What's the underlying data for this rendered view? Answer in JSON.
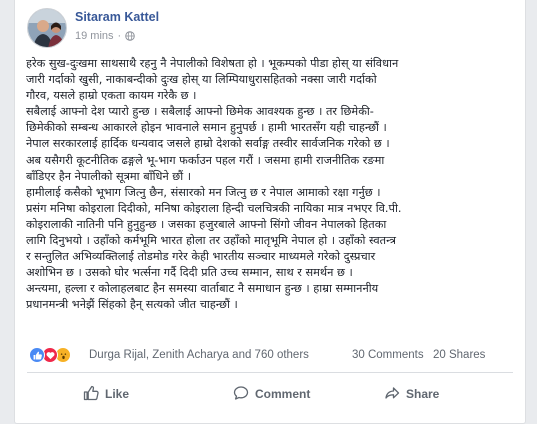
{
  "post": {
    "author": "Sitaram Kattel",
    "time": "19 mins",
    "separator": "·",
    "lines": [
      "हरेक सुख-दुःखमा साथसाथै रहनु नै नेपालीको विशेषता हो । भूकम्पको पीडा होस् या संविधान",
      "जारी गर्दाको खुसी, नाकाबन्दीको दुःख होस् या लिम्पियाधुरासहितको नक्सा जारी गर्दाको",
      "गौरव, यसले हाम्रो एकता कायम गरेकै छ ।",
      "सबैलाई आफ्नो देश प्यारो हुन्छ । सबैलाई आफ्नो छिमेक आवश्यक हुन्छ । तर छिमेकी-",
      "छिमेकीको सम्बन्ध आकारले होइन भावनाले समान हुनुपर्छ । हामी भारतसँग यही चाहन्छौं ।",
      "नेपाल सरकारलाई हार्दिक धन्यवाद जसले हाम्रो देशको सर्वाङ्ग तस्वीर सार्वजनिक गरेको छ ।",
      "अब यसैगरी कूटनीतिक ढङ्गले भू-भाग फर्काउन पहल गरौं । जसमा हामी राजनीतिक रङमा",
      "बाँडिएर हैन नेपालीको सूत्रमा बाँधिने छौं ।",
      "हामीलाई कसैको भूभाग जित्नु छैन, संसारको मन जित्नु छ र नेपाल आमाको रक्षा गर्नुछ ।",
      "प्रसंग मनिषा कोइराला दिदीको, मनिषा कोइराला हिन्दी चलचित्रकी नायिका मात्र नभएर वि.पी.",
      "कोइरालाकी नातिनी पनि हुनुहुन्छ । जसका हजुरबाले आफ्नो सिंगो जीवन नेपालको हितका",
      "लागि दिनुभयो । उहाँको कर्मभूमि भारत होला तर उहाँको मातृभूमि नेपाल हो । उहाँको स्वतन्त्र",
      "र सन्तुलित अभिव्यक्तिलाई तोडमोड गरेर केही भारतीय सञ्चार माध्यमले गरेको दुस्प्रचार",
      "अशोभिन छ । उसको घोर भर्त्सना गर्दै दिदी प्रति उच्च सम्मान, साथ र समर्थन छ ।",
      "अन्त्यमा, हल्ला र कोलाहलबाट हैन समस्या वार्ताबाट नै समाधान हुन्छ । हाम्रा सम्माननीय",
      "प्रधानमन्त्री भनेझैं सिंहको हैन् सत्यको जीत चाहन्छौं ।"
    ]
  },
  "stats": {
    "reactors": "Durga Rijal, Zenith Acharya and 760 others",
    "comments": "30 Comments",
    "shares": "20 Shares"
  },
  "actions": {
    "like": "Like",
    "comment": "Comment",
    "share": "Share"
  },
  "colors": {
    "author_link": "#385898",
    "like_reaction": "#4a8af4",
    "love_reaction": "#f0284a",
    "wow_reaction": "#f7b125"
  },
  "icons": [
    "globe-icon",
    "like-reaction-icon",
    "love-reaction-icon",
    "wow-reaction-icon",
    "thumbs-up-icon",
    "comment-icon",
    "share-icon"
  ]
}
